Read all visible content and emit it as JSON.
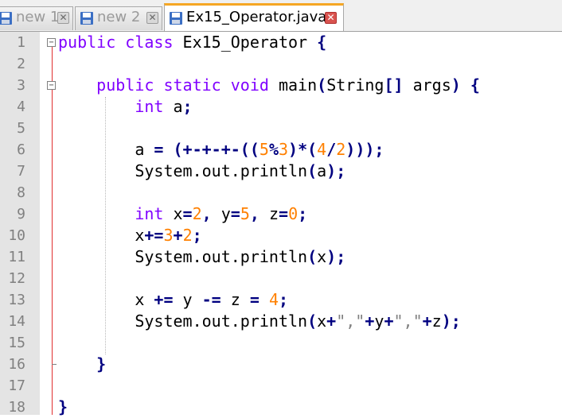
{
  "tabs": [
    {
      "label": "new 1",
      "active": false
    },
    {
      "label": "new 2",
      "active": false
    },
    {
      "label": "Ex15_Operator.java",
      "active": true
    }
  ],
  "colors": {
    "keyword": "#8000ff",
    "operator": "#000080",
    "number": "#ff8000",
    "string": "#808080",
    "active_tab_accent": "#f5a623",
    "fold_line": "#e03030"
  },
  "editor": {
    "lines": [
      [
        [
          "kw",
          "public"
        ],
        [
          "t",
          " "
        ],
        [
          "kw",
          "class"
        ],
        [
          "t",
          " Ex15_Operator "
        ],
        [
          "op",
          "{"
        ]
      ],
      [],
      [
        [
          "t",
          "    "
        ],
        [
          "kw",
          "public"
        ],
        [
          "t",
          " "
        ],
        [
          "kw",
          "static"
        ],
        [
          "t",
          " "
        ],
        [
          "kt",
          "void"
        ],
        [
          "t",
          " main"
        ],
        [
          "op",
          "("
        ],
        [
          "t",
          "String"
        ],
        [
          "op",
          "[]"
        ],
        [
          "t",
          " args"
        ],
        [
          "op",
          ")"
        ],
        [
          "t",
          " "
        ],
        [
          "op",
          "{"
        ]
      ],
      [
        [
          "t",
          "        "
        ],
        [
          "kt",
          "int"
        ],
        [
          "t",
          " a"
        ],
        [
          "op",
          ";"
        ]
      ],
      [],
      [
        [
          "t",
          "        a "
        ],
        [
          "op",
          "="
        ],
        [
          "t",
          " "
        ],
        [
          "op",
          "(+-+-+-(("
        ],
        [
          "num",
          "5"
        ],
        [
          "op",
          "%"
        ],
        [
          "num",
          "3"
        ],
        [
          "op",
          ")*("
        ],
        [
          "num",
          "4"
        ],
        [
          "op",
          "/"
        ],
        [
          "num",
          "2"
        ],
        [
          "op",
          ")));"
        ]
      ],
      [
        [
          "t",
          "        System.out.println"
        ],
        [
          "op",
          "("
        ],
        [
          "t",
          "a"
        ],
        [
          "op",
          ");"
        ]
      ],
      [],
      [
        [
          "t",
          "        "
        ],
        [
          "kt",
          "int"
        ],
        [
          "t",
          " x"
        ],
        [
          "op",
          "="
        ],
        [
          "num",
          "2"
        ],
        [
          "op",
          ","
        ],
        [
          "t",
          " y"
        ],
        [
          "op",
          "="
        ],
        [
          "num",
          "5"
        ],
        [
          "op",
          ","
        ],
        [
          "t",
          " z"
        ],
        [
          "op",
          "="
        ],
        [
          "num",
          "0"
        ],
        [
          "op",
          ";"
        ]
      ],
      [
        [
          "t",
          "        x"
        ],
        [
          "op",
          "+="
        ],
        [
          "num",
          "3"
        ],
        [
          "op",
          "+"
        ],
        [
          "num",
          "2"
        ],
        [
          "op",
          ";"
        ]
      ],
      [
        [
          "t",
          "        System.out.println"
        ],
        [
          "op",
          "("
        ],
        [
          "t",
          "x"
        ],
        [
          "op",
          ");"
        ]
      ],
      [],
      [
        [
          "t",
          "        x "
        ],
        [
          "op",
          "+="
        ],
        [
          "t",
          " y "
        ],
        [
          "op",
          "-="
        ],
        [
          "t",
          " z "
        ],
        [
          "op",
          "="
        ],
        [
          "t",
          " "
        ],
        [
          "num",
          "4"
        ],
        [
          "op",
          ";"
        ]
      ],
      [
        [
          "t",
          "        System.out.println"
        ],
        [
          "op",
          "("
        ],
        [
          "t",
          "x"
        ],
        [
          "op",
          "+"
        ],
        [
          "str",
          "\",\""
        ],
        [
          "op",
          "+"
        ],
        [
          "t",
          "y"
        ],
        [
          "op",
          "+"
        ],
        [
          "str",
          "\",\""
        ],
        [
          "op",
          "+"
        ],
        [
          "t",
          "z"
        ],
        [
          "op",
          ");"
        ]
      ],
      [],
      [
        [
          "t",
          "    "
        ],
        [
          "op",
          "}"
        ]
      ],
      [],
      [
        [
          "op",
          "}"
        ]
      ]
    ]
  }
}
